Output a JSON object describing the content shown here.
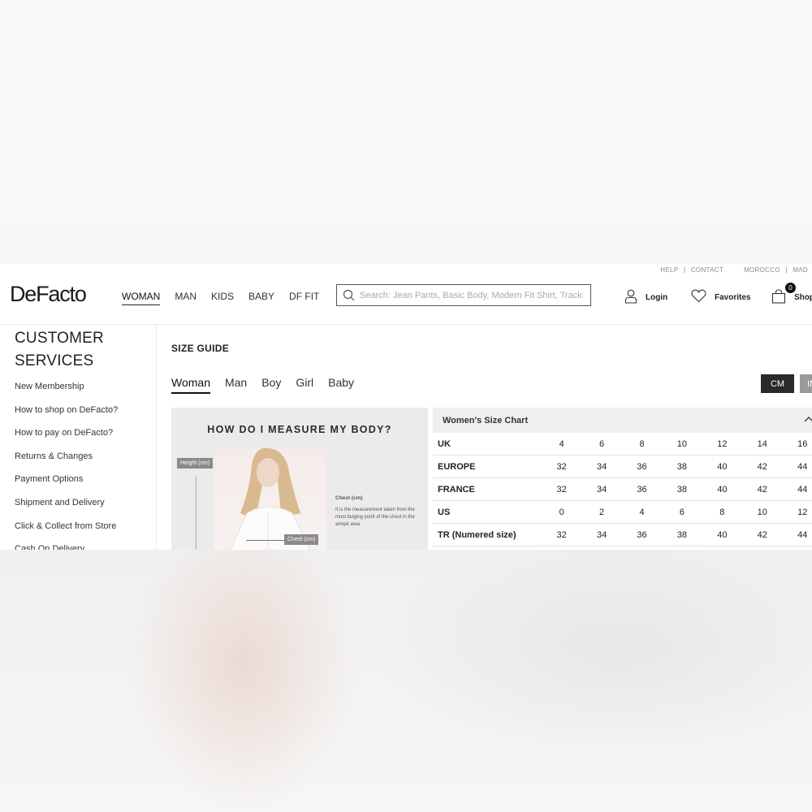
{
  "util": {
    "help": "HELP",
    "sep": "|",
    "contact": "CONTACT",
    "country": "MOROCCO",
    "lang": "MAD"
  },
  "brand": {
    "logo": "DeFacto"
  },
  "nav": [
    "WOMAN",
    "MAN",
    "KIDS",
    "BABY",
    "DF FIT"
  ],
  "search": {
    "placeholder": "Search: Jean Pants, Basic Body, Modern Fit Shirt, Tracksuit"
  },
  "header": {
    "login": "Login",
    "favorites": "Favorites",
    "shop": "Shop",
    "cart_count": "0"
  },
  "sidebar": {
    "title_line1": "CUSTOMER",
    "title_line2": "SERVICES",
    "items": [
      "New Membership",
      "How to shop on DeFacto?",
      "How to pay on DeFacto?",
      "Returns & Changes",
      "Payment Options",
      "Shipment and Delivery",
      "Click & Collect from Store",
      "Cash On Delivery"
    ]
  },
  "main": {
    "title": "SIZE GUIDE",
    "tabs": [
      "Woman",
      "Man",
      "Boy",
      "Girl",
      "Baby"
    ],
    "unit_cm": "CM",
    "unit_in": "IN"
  },
  "measure": {
    "title": "HOW DO I MEASURE MY BODY?",
    "height_tag": "Height (cm)",
    "chest_tag": "Chest (cm)",
    "chest_label": "Chest (cm)",
    "chest_desc": "It is the measurement taken from the most bulging point of the chest in the armpit area."
  },
  "size_chart": {
    "title": "Women's Size Chart",
    "rows": [
      {
        "label": "UK",
        "values": [
          "4",
          "6",
          "8",
          "10",
          "12",
          "14",
          "16"
        ]
      },
      {
        "label": "EUROPE",
        "values": [
          "32",
          "34",
          "36",
          "38",
          "40",
          "42",
          "44"
        ]
      },
      {
        "label": "FRANCE",
        "values": [
          "32",
          "34",
          "36",
          "38",
          "40",
          "42",
          "44"
        ]
      },
      {
        "label": "US",
        "values": [
          "0",
          "2",
          "4",
          "6",
          "8",
          "10",
          "12"
        ]
      },
      {
        "label": "TR (Numered size)",
        "values": [
          "32",
          "34",
          "36",
          "38",
          "40",
          "42",
          "44"
        ]
      }
    ]
  },
  "colors": {
    "primary": "#2a2a2a",
    "secondary_button": "#9a9a9a",
    "panel": "#ebebeb"
  }
}
